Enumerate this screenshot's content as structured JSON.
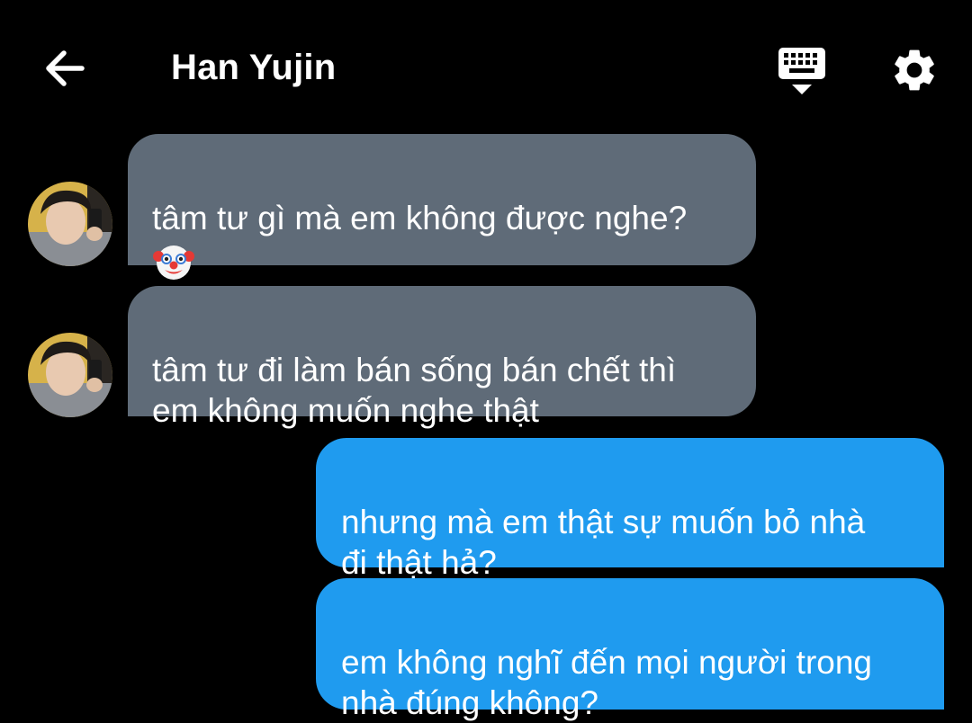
{
  "header": {
    "title": "Han Yujin",
    "back_icon": "arrow-left-icon",
    "keyboard_icon": "keyboard-hide-icon",
    "settings_icon": "gear-icon"
  },
  "colors": {
    "background": "#000000",
    "incoming_bubble": "#5f6b78",
    "outgoing_bubble": "#1f9bef",
    "text": "#ffffff"
  },
  "messages": [
    {
      "direction": "incoming",
      "text": "tâm tư gì mà em không được nghe?",
      "emoji": "clown-face-emoji"
    },
    {
      "direction": "incoming",
      "text": "tâm tư đi làm bán sống bán chết thì\nem không muốn nghe thật"
    },
    {
      "direction": "outgoing",
      "text": "nhưng mà em thật sự muốn bỏ nhà\nđi thật hả?"
    },
    {
      "direction": "outgoing",
      "text": "em không nghĩ đến mọi người trong\nnhà đúng không?"
    }
  ]
}
